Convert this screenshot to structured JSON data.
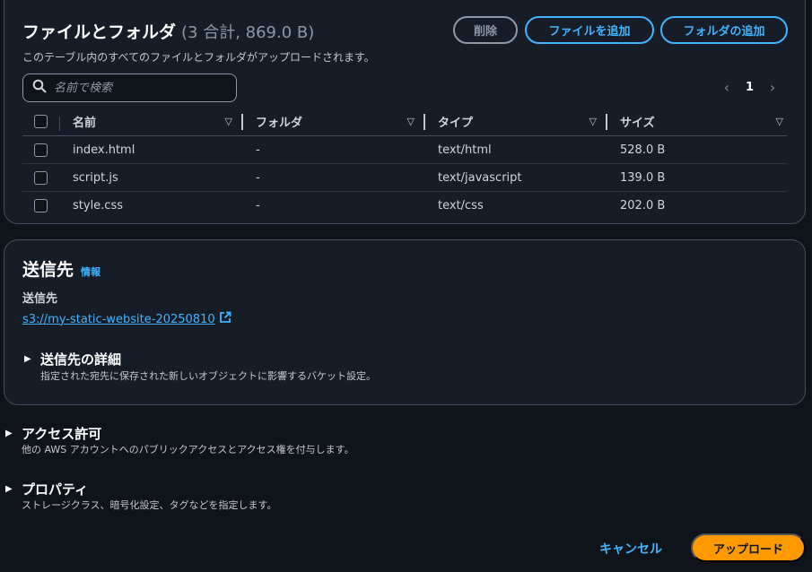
{
  "files": {
    "title": "ファイルとフォルダ",
    "count": "(3 合計, 869.0 B)",
    "description": "このテーブル内のすべてのファイルとフォルダがアップロードされます。",
    "delete_label": "削除",
    "add_files_label": "ファイルを追加",
    "add_folder_label": "フォルダの追加",
    "search_placeholder": "名前で検索",
    "page": "1",
    "columns": [
      "名前",
      "フォルダ",
      "タイプ",
      "サイズ"
    ],
    "rows": [
      {
        "name": "index.html",
        "folder": "-",
        "type": "text/html",
        "size": "528.0 B"
      },
      {
        "name": "script.js",
        "folder": "-",
        "type": "text/javascript",
        "size": "139.0 B"
      },
      {
        "name": "style.css",
        "folder": "-",
        "type": "text/css",
        "size": "202.0 B"
      }
    ]
  },
  "destination": {
    "title": "送信先",
    "info_label": "情報",
    "label": "送信先",
    "url": "s3://my-static-website-20250810",
    "details_title": "送信先の詳細",
    "details_desc": "指定された宛先に保存された新しいオブジェクトに影響するバケット設定。"
  },
  "permissions": {
    "title": "アクセス許可",
    "desc": "他の AWS アカウントへのパブリックアクセスとアクセス権を付与します。"
  },
  "properties": {
    "title": "プロパティ",
    "desc": "ストレージクラス、暗号化設定、タグなどを指定します。"
  },
  "footer": {
    "cancel_label": "キャンセル",
    "upload_label": "アップロード"
  },
  "colors": {
    "background": "#0f141a",
    "panel": "#161d26",
    "link": "#42b4ff",
    "primary": "#ff9900"
  }
}
